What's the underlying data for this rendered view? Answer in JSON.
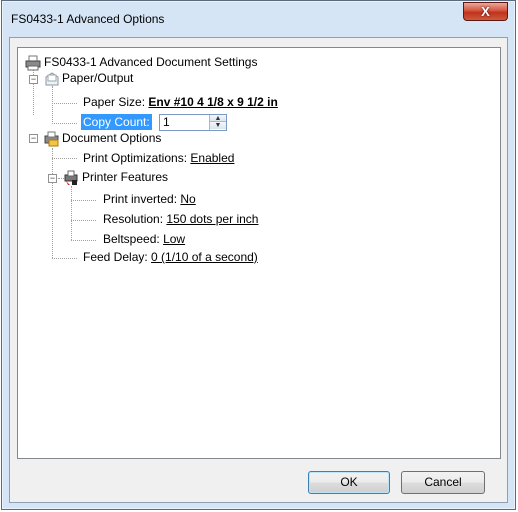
{
  "window": {
    "title": "FS0433-1 Advanced Options",
    "close_glyph": "X"
  },
  "tree": {
    "root": "FS0433-1 Advanced Document Settings",
    "paper_output": {
      "label": "Paper/Output",
      "paper_size_label": "Paper Size:",
      "paper_size_value": "Env #10 4 1/8 x 9 1/2 in",
      "copy_count_label": "Copy Count:",
      "copy_count_value": "1"
    },
    "document_options": {
      "label": "Document Options",
      "print_optimizations_label": "Print Optimizations:",
      "print_optimizations_value": "Enabled",
      "printer_features": {
        "label": "Printer Features",
        "print_inverted_label": "Print inverted:",
        "print_inverted_value": "No",
        "resolution_label": "Resolution:",
        "resolution_value": "150 dots per inch",
        "beltspeed_label": "Beltspeed:",
        "beltspeed_value": "Low"
      },
      "feed_delay_label": "Feed Delay:",
      "feed_delay_value": "0  (1/10 of a second)"
    }
  },
  "buttons": {
    "ok": "OK",
    "cancel": "Cancel"
  },
  "icons": {
    "root": "printer-icon",
    "paper_output": "paper-icon",
    "document_options": "document-options-icon",
    "printer_features": "printer-features-icon"
  },
  "colors": {
    "selection": "#3399ff",
    "close_button": "#c7402a"
  }
}
